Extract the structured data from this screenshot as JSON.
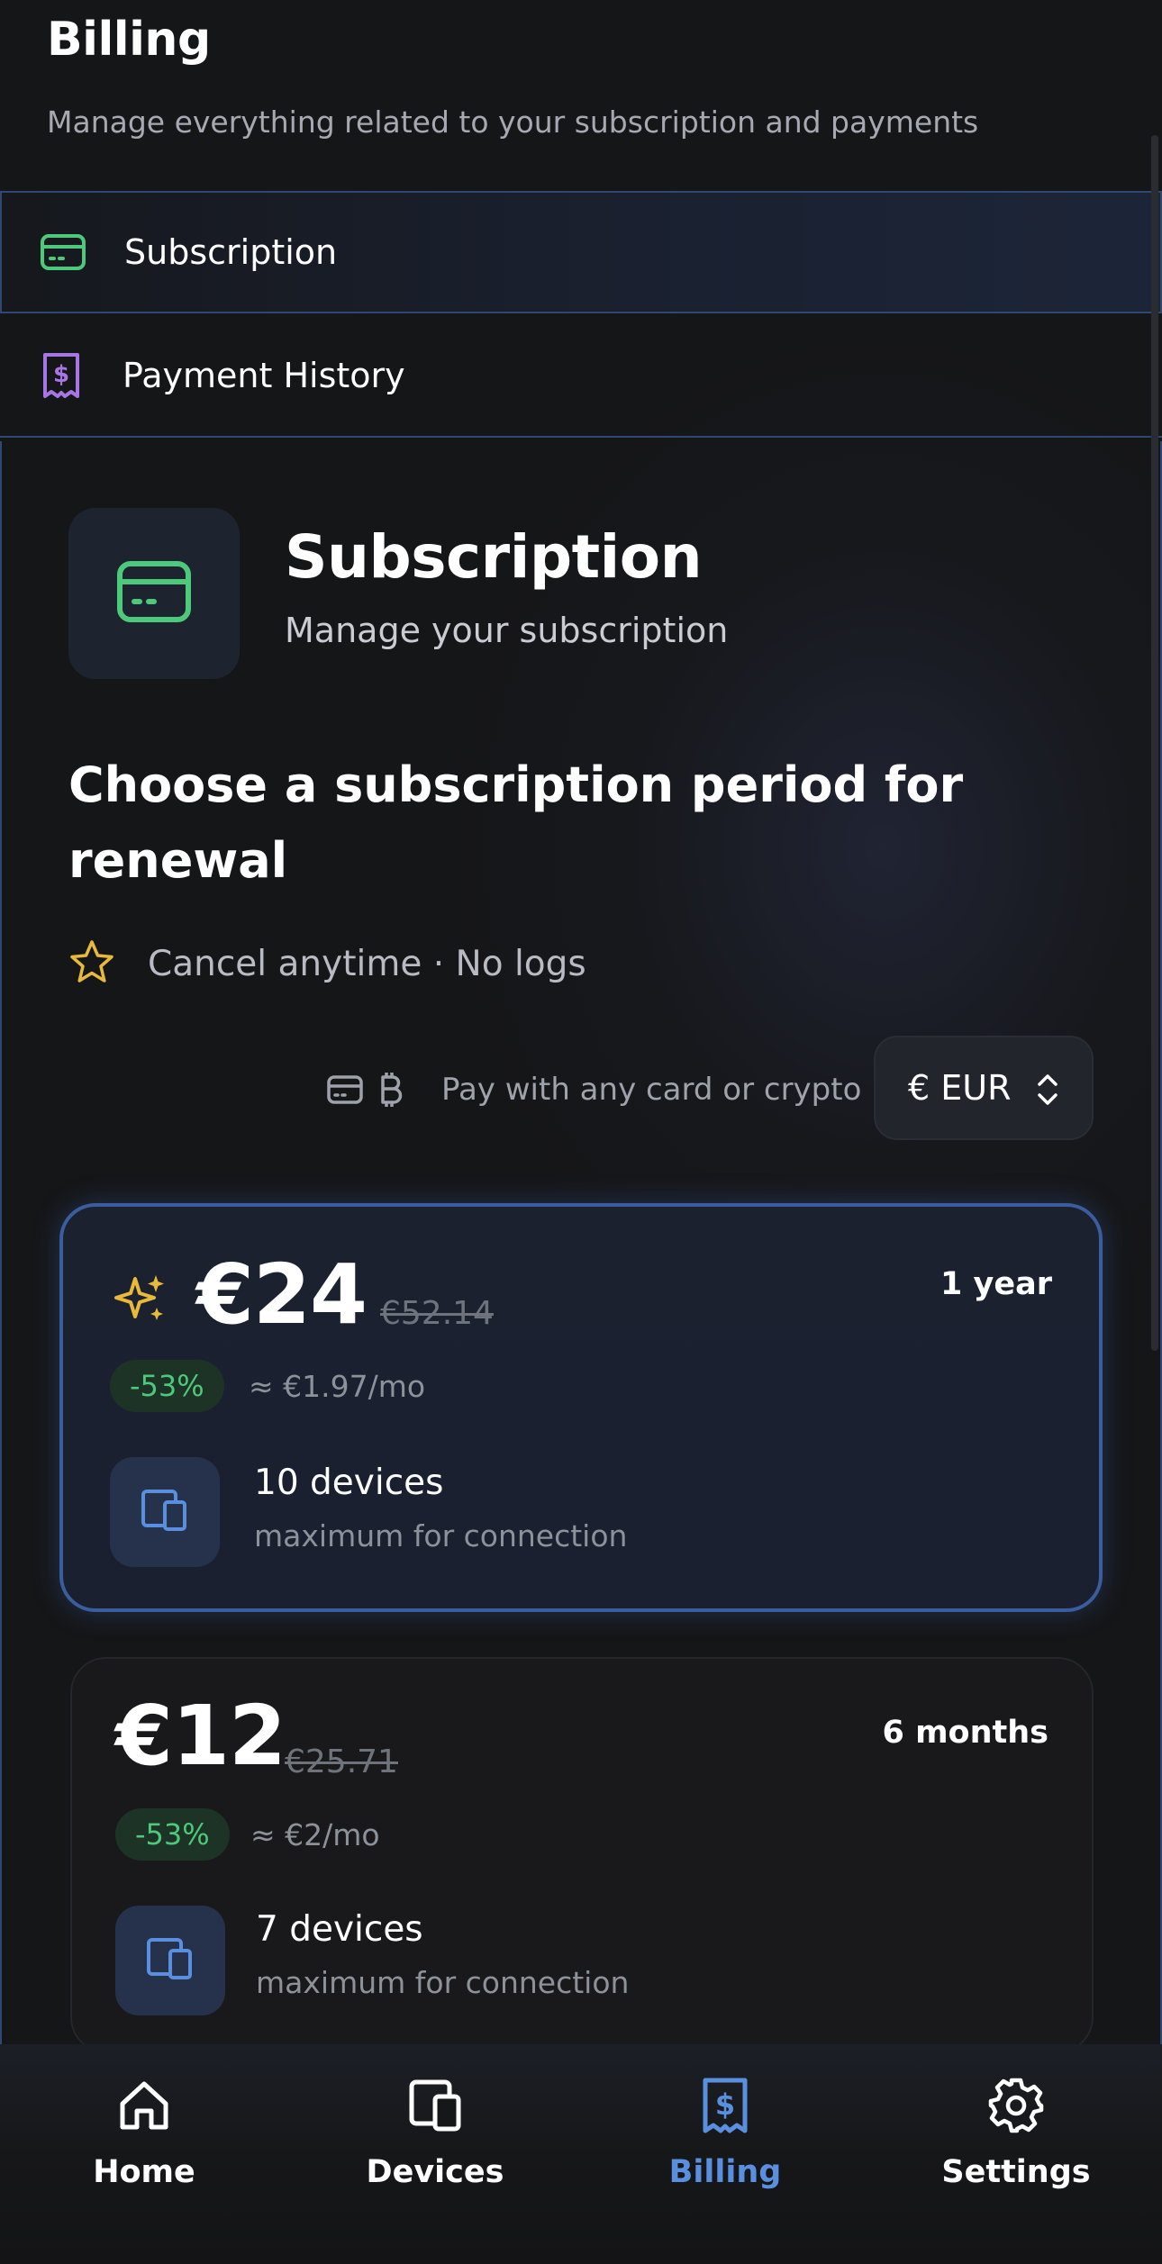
{
  "header": {
    "title": "Billing",
    "subtitle": "Manage everything related to your subscription and payments"
  },
  "nav": {
    "items": [
      {
        "label": "Subscription",
        "icon": "credit-card-icon",
        "active": true,
        "color": "#4cc97a"
      },
      {
        "label": "Payment History",
        "icon": "receipt-dollar-icon",
        "active": false,
        "color": "#a875e6"
      }
    ]
  },
  "subscription": {
    "title": "Subscription",
    "description": "Manage your subscription",
    "icon": "credit-card-icon",
    "icon_color": "#4cc97a",
    "choose_title": "Choose a subscription period for renewal",
    "perks": "Cancel anytime · No logs",
    "perks_icon": "star-icon",
    "payment_note": "Pay with any card or crypto",
    "currency": "€ EUR"
  },
  "plans": [
    {
      "price": "€24",
      "old_price": "€52.14",
      "period": "1 year",
      "discount": "-53%",
      "per_month": "≈ €1.97/mo",
      "devices": "10 devices",
      "devices_sub": "maximum for connection",
      "selected": true
    },
    {
      "price": "€12",
      "old_price": "€25.71",
      "period": "6 months",
      "discount": "-53%",
      "per_month": "≈ €2/mo",
      "devices": "7 devices",
      "devices_sub": "maximum for connection",
      "selected": false
    }
  ],
  "bottom_nav": {
    "items": [
      {
        "label": "Home",
        "icon": "home-icon",
        "active": false
      },
      {
        "label": "Devices",
        "icon": "devices-icon",
        "active": false
      },
      {
        "label": "Billing",
        "icon": "receipt-dollar-icon",
        "active": true
      },
      {
        "label": "Settings",
        "icon": "gear-icon",
        "active": false
      }
    ]
  },
  "colors": {
    "accent": "#5a8fe0",
    "success": "#4cc97a",
    "star": "#e8b93a",
    "background": "#151618"
  }
}
